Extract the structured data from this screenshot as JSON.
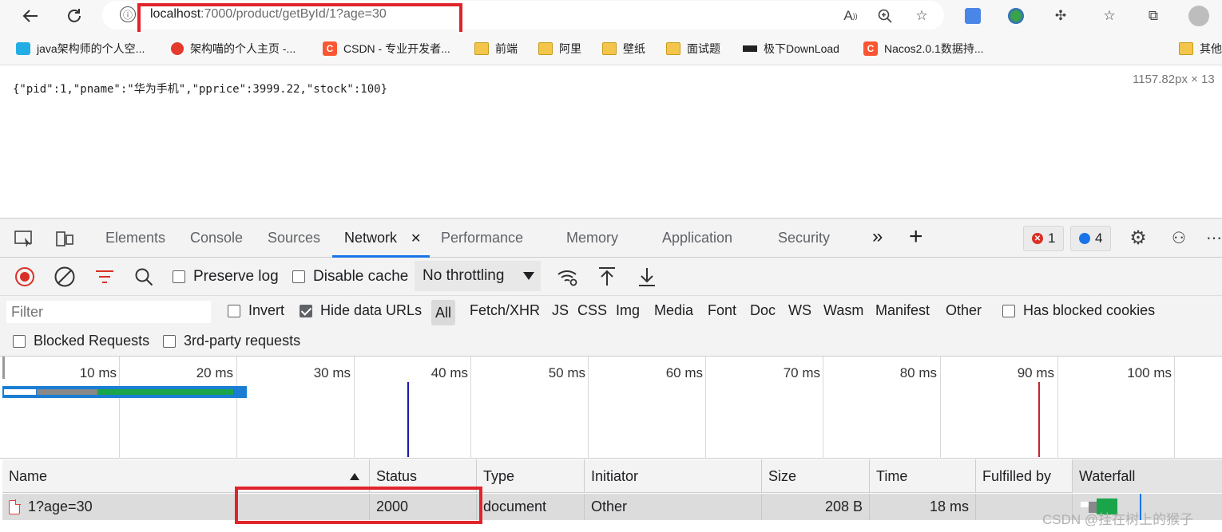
{
  "browser": {
    "url_host": "localhost",
    "url_path": ":7000/product/getById/1?age=30",
    "info_icon": "ⓘ"
  },
  "bookmarks": [
    {
      "label": "java架构师的个人空...",
      "icon": "bilibili-icon"
    },
    {
      "label": "架构喵的个人主页 -...",
      "icon": "video-icon"
    },
    {
      "label": "CSDN - 专业开发者...",
      "icon": "csdn-icon"
    },
    {
      "label": "前端",
      "icon": "folder-icon"
    },
    {
      "label": "阿里",
      "icon": "folder-icon"
    },
    {
      "label": "壁纸",
      "icon": "folder-icon"
    },
    {
      "label": "面试题",
      "icon": "folder-icon"
    },
    {
      "label": "极下DownLoad",
      "icon": "download-site-icon"
    },
    {
      "label": "Nacos2.0.1数据持...",
      "icon": "csdn-icon"
    },
    {
      "label": "其他",
      "icon": "folder-icon"
    }
  ],
  "page": {
    "json_body": "{\"pid\":1,\"pname\":\"华为手机\",\"pprice\":3999.22,\"stock\":100}",
    "dimensions": "1157.82px × 13"
  },
  "devtools": {
    "tabs": [
      "Elements",
      "Console",
      "Sources",
      "Network",
      "Performance",
      "Memory",
      "Application",
      "Security"
    ],
    "active_tab": "Network",
    "close_glyph": "✕",
    "more_glyph": "»",
    "add_glyph": "+",
    "error_count": "1",
    "message_count": "4"
  },
  "network_toolbar": {
    "preserve_log": "Preserve log",
    "disable_cache": "Disable cache",
    "throttling": "No throttling"
  },
  "filter_bar": {
    "placeholder": "Filter",
    "invert": "Invert",
    "hide_data_urls": "Hide data URLs",
    "types": [
      "All",
      "Fetch/XHR",
      "JS",
      "CSS",
      "Img",
      "Media",
      "Font",
      "Doc",
      "WS",
      "Wasm",
      "Manifest",
      "Other"
    ],
    "has_blocked_cookies": "Has blocked cookies",
    "blocked_requests": "Blocked Requests",
    "third_party": "3rd-party requests"
  },
  "timeline": {
    "ticks": [
      "10 ms",
      "20 ms",
      "30 ms",
      "40 ms",
      "50 ms",
      "60 ms",
      "70 ms",
      "80 ms",
      "90 ms",
      "100 ms"
    ],
    "dom_content_loaded_color": "#1a1aa8",
    "load_color": "#c8242b"
  },
  "table": {
    "headers": [
      "Name",
      "Status",
      "Type",
      "Initiator",
      "Size",
      "Time",
      "Fulfilled by",
      "Waterfall"
    ],
    "rows": [
      {
        "name": "1?age=30",
        "status": "2000",
        "type": "document",
        "initiator": "Other",
        "size": "208 B",
        "time": "18 ms",
        "fulfilled_by": ""
      }
    ]
  },
  "watermark": "CSDN @挂在树上的猴子",
  "colors": {
    "highlight_box": "#e0242b",
    "accent": "#1a73e8",
    "record": "#d93025"
  }
}
